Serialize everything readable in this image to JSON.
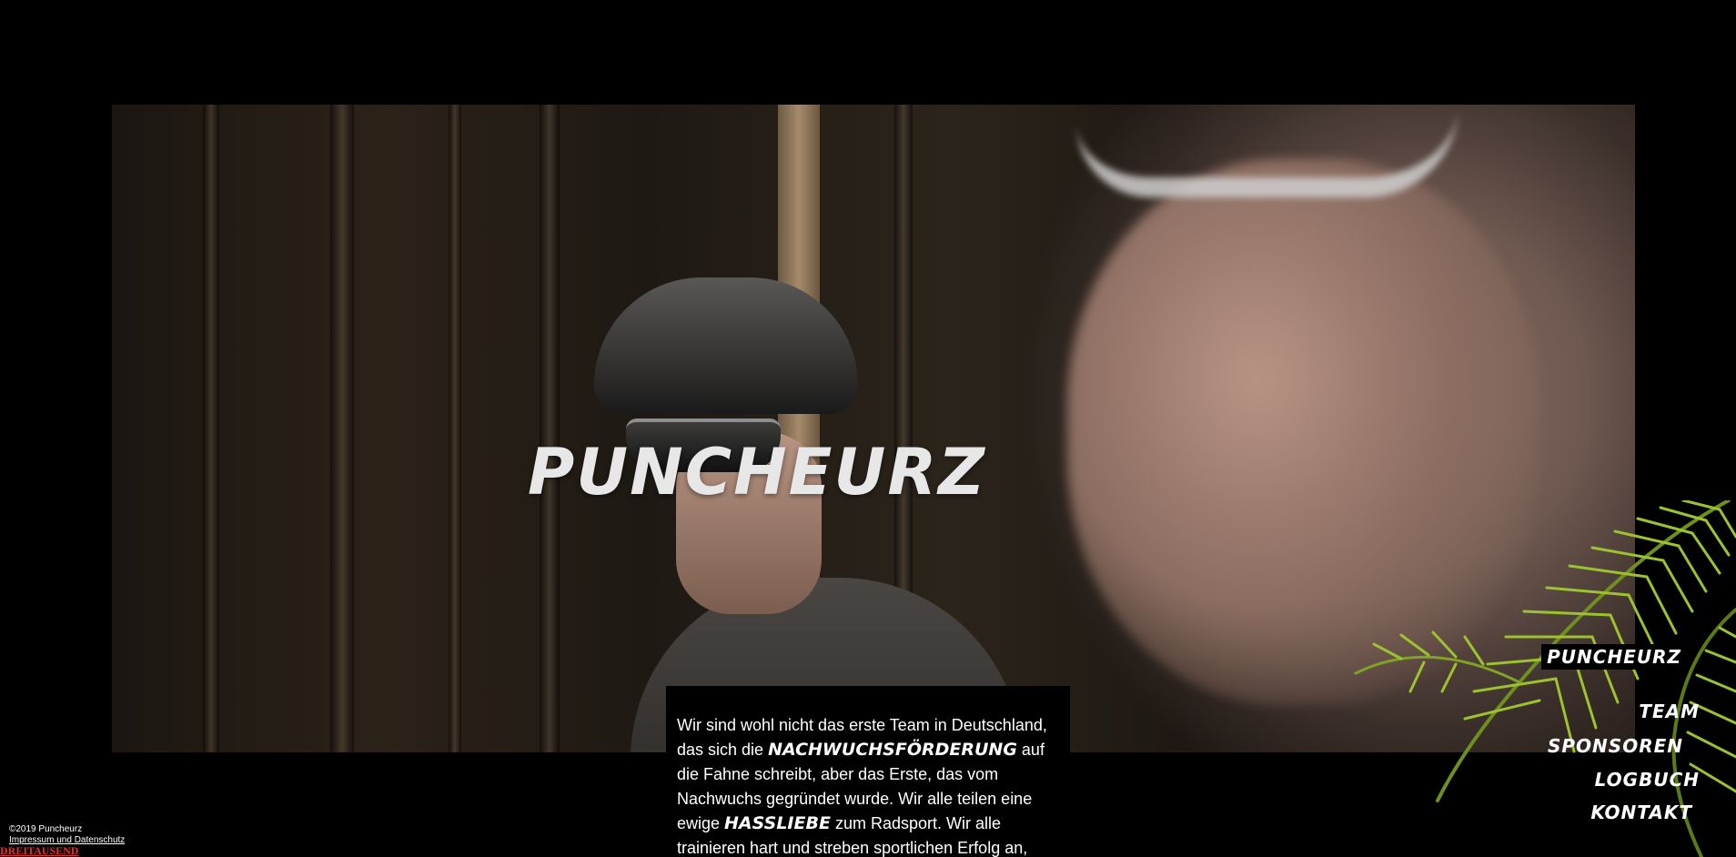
{
  "hero": {
    "title": "PUNCHEURZ"
  },
  "intro": {
    "text_1": "Wir sind wohl nicht das erste Team in Deutschland, das sich die ",
    "emphasis_1": "NACHWUCHSFÖRDERUNG",
    "text_2": " auf die Fahne schreibt, aber das Erste, das vom Nachwuchs gegründet wurde. Wir alle teilen eine ewige ",
    "emphasis_2": "HASSLIEBE",
    "text_3": " zum Radsport. Wir alle trainieren hart und streben sportlichen Erfolg an,"
  },
  "nav": {
    "items": [
      {
        "label": "PUNCHEURZ"
      },
      {
        "label": "TEAM"
      },
      {
        "label": "SPONSOREN"
      },
      {
        "label": "LOGBUCH"
      },
      {
        "label": "KONTAKT"
      }
    ]
  },
  "footer": {
    "copyright": "©2019 Puncheurz",
    "legal_link": "Impressum und Datenschutz",
    "credit": "DREITAUSEND"
  },
  "colors": {
    "background": "#000000",
    "text": "#ffffff",
    "credit": "#e03030",
    "palm": "#8fb52a"
  }
}
